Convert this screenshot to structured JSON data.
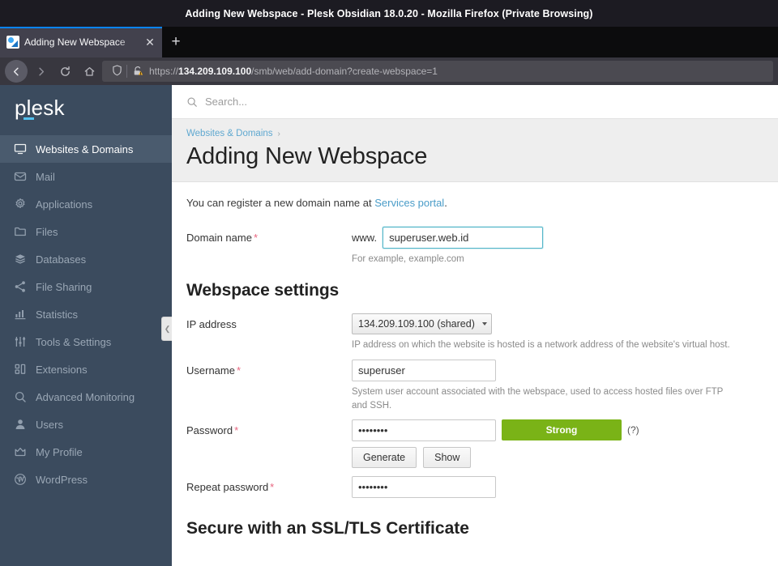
{
  "browser": {
    "window_title": "Adding New Webspace - Plesk Obsidian 18.0.20 - Mozilla Firefox (Private Browsing)",
    "tab_title": "Adding New Webspace",
    "tab_close_label": "✕",
    "new_tab_label": "+",
    "back_label": "←",
    "forward_label": "→",
    "reload_label": "⟳",
    "home_label": "⌂",
    "url_scheme": "https://",
    "url_host": "134.209.109.100",
    "url_path": "/smb/web/add-domain?create-webspace=1"
  },
  "sidebar": {
    "brand": "plesk",
    "collapse_label": "❮",
    "items": [
      {
        "label": "Websites & Domains",
        "icon": "monitor-icon",
        "active": true
      },
      {
        "label": "Mail",
        "icon": "envelope-icon",
        "active": false
      },
      {
        "label": "Applications",
        "icon": "gear-icon",
        "active": false
      },
      {
        "label": "Files",
        "icon": "folder-icon",
        "active": false
      },
      {
        "label": "Databases",
        "icon": "database-icon",
        "active": false
      },
      {
        "label": "File Sharing",
        "icon": "share-icon",
        "active": false
      },
      {
        "label": "Statistics",
        "icon": "bar-chart-icon",
        "active": false
      },
      {
        "label": "Tools & Settings",
        "icon": "sliders-icon",
        "active": false
      },
      {
        "label": "Extensions",
        "icon": "blocks-icon",
        "active": false
      },
      {
        "label": "Advanced Monitoring",
        "icon": "magnifier-icon",
        "active": false
      },
      {
        "label": "Users",
        "icon": "user-icon",
        "active": false
      },
      {
        "label": "My Profile",
        "icon": "crown-icon",
        "active": false
      },
      {
        "label": "WordPress",
        "icon": "wordpress-icon",
        "active": false
      }
    ]
  },
  "search": {
    "placeholder": "Search..."
  },
  "page": {
    "breadcrumb_item": "Websites & Domains",
    "breadcrumb_sep": "›",
    "title": "Adding New Webspace"
  },
  "form": {
    "intro_prefix": "You can register a new domain name at ",
    "intro_link": "Services portal",
    "intro_suffix": ".",
    "domain": {
      "label": "Domain name",
      "required_mark": "*",
      "prefix": "www.",
      "value": "superuser.web.id",
      "hint": "For example, example.com"
    },
    "webspace_settings_title": "Webspace settings",
    "ip": {
      "label": "IP address",
      "value": "134.209.109.100 (shared)",
      "options": [
        "134.209.109.100 (shared)"
      ],
      "hint": "IP address on which the website is hosted is a network address of the website's virtual host."
    },
    "username": {
      "label": "Username",
      "required_mark": "*",
      "value": "superuser",
      "hint": "System user account associated with the webspace, used to access hosted files over FTP and SSH."
    },
    "password": {
      "label": "Password",
      "required_mark": "*",
      "value": "••••••••",
      "strength_label": "Strong",
      "strength_percent": 100,
      "strength_color": "#7ab317",
      "help_label": "(?)",
      "generate_label": "Generate",
      "show_label": "Show"
    },
    "repeat_password": {
      "label": "Repeat password",
      "required_mark": "*",
      "value": "••••••••"
    }
  },
  "ssl": {
    "title": "Secure with an SSL/TLS Certificate"
  }
}
